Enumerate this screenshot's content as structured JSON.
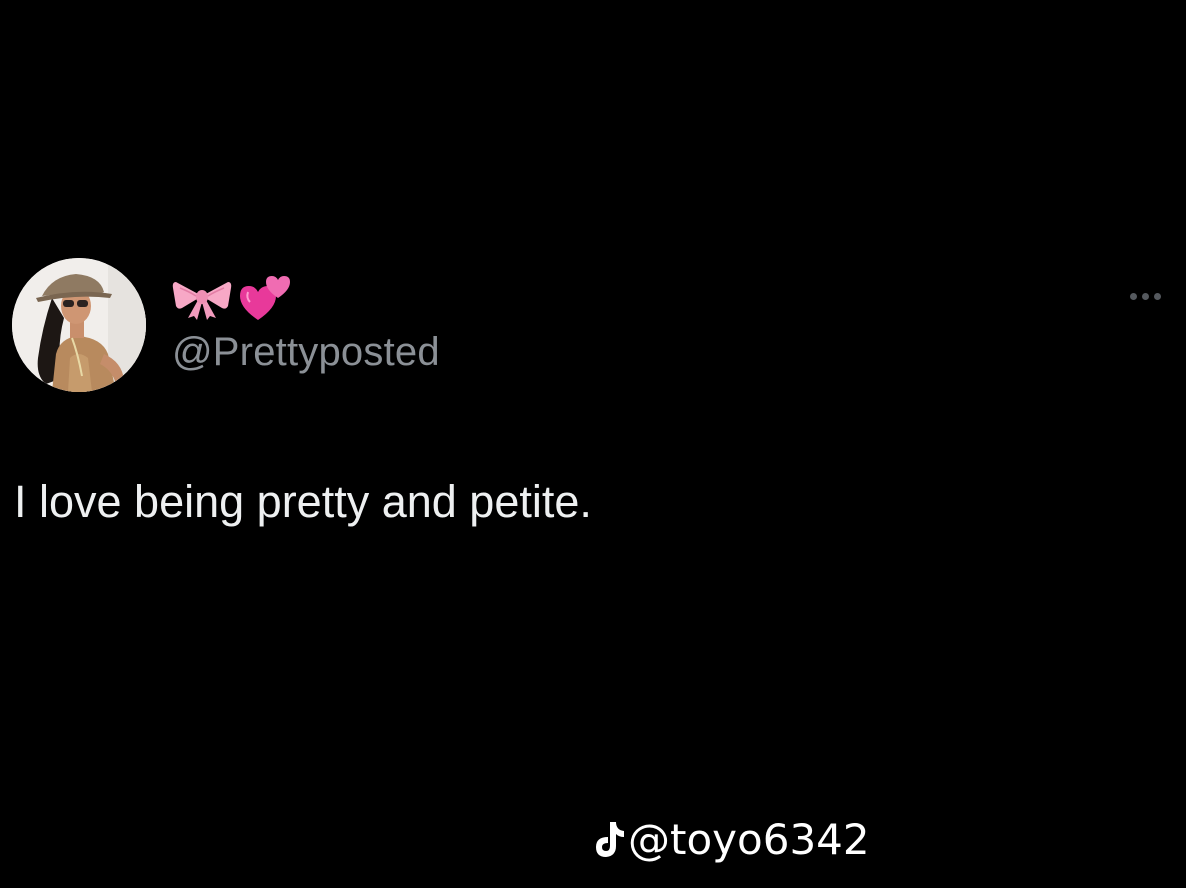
{
  "tweet": {
    "display_name_icons": [
      "ribbon-bow-icon",
      "two-hearts-icon"
    ],
    "handle": "@Prettyposted",
    "text": "I love being pretty and petite.",
    "more_icon": "ellipsis-icon"
  },
  "watermark": {
    "icon": "tiktok-icon",
    "text": "@toyo6342"
  },
  "colors": {
    "background": "#000000",
    "text": "#eef0f1",
    "handle": "#8b9096",
    "more_icon": "#55595e",
    "bow_pink": "#f7a8c6",
    "heart_pink": "#e8399a"
  }
}
